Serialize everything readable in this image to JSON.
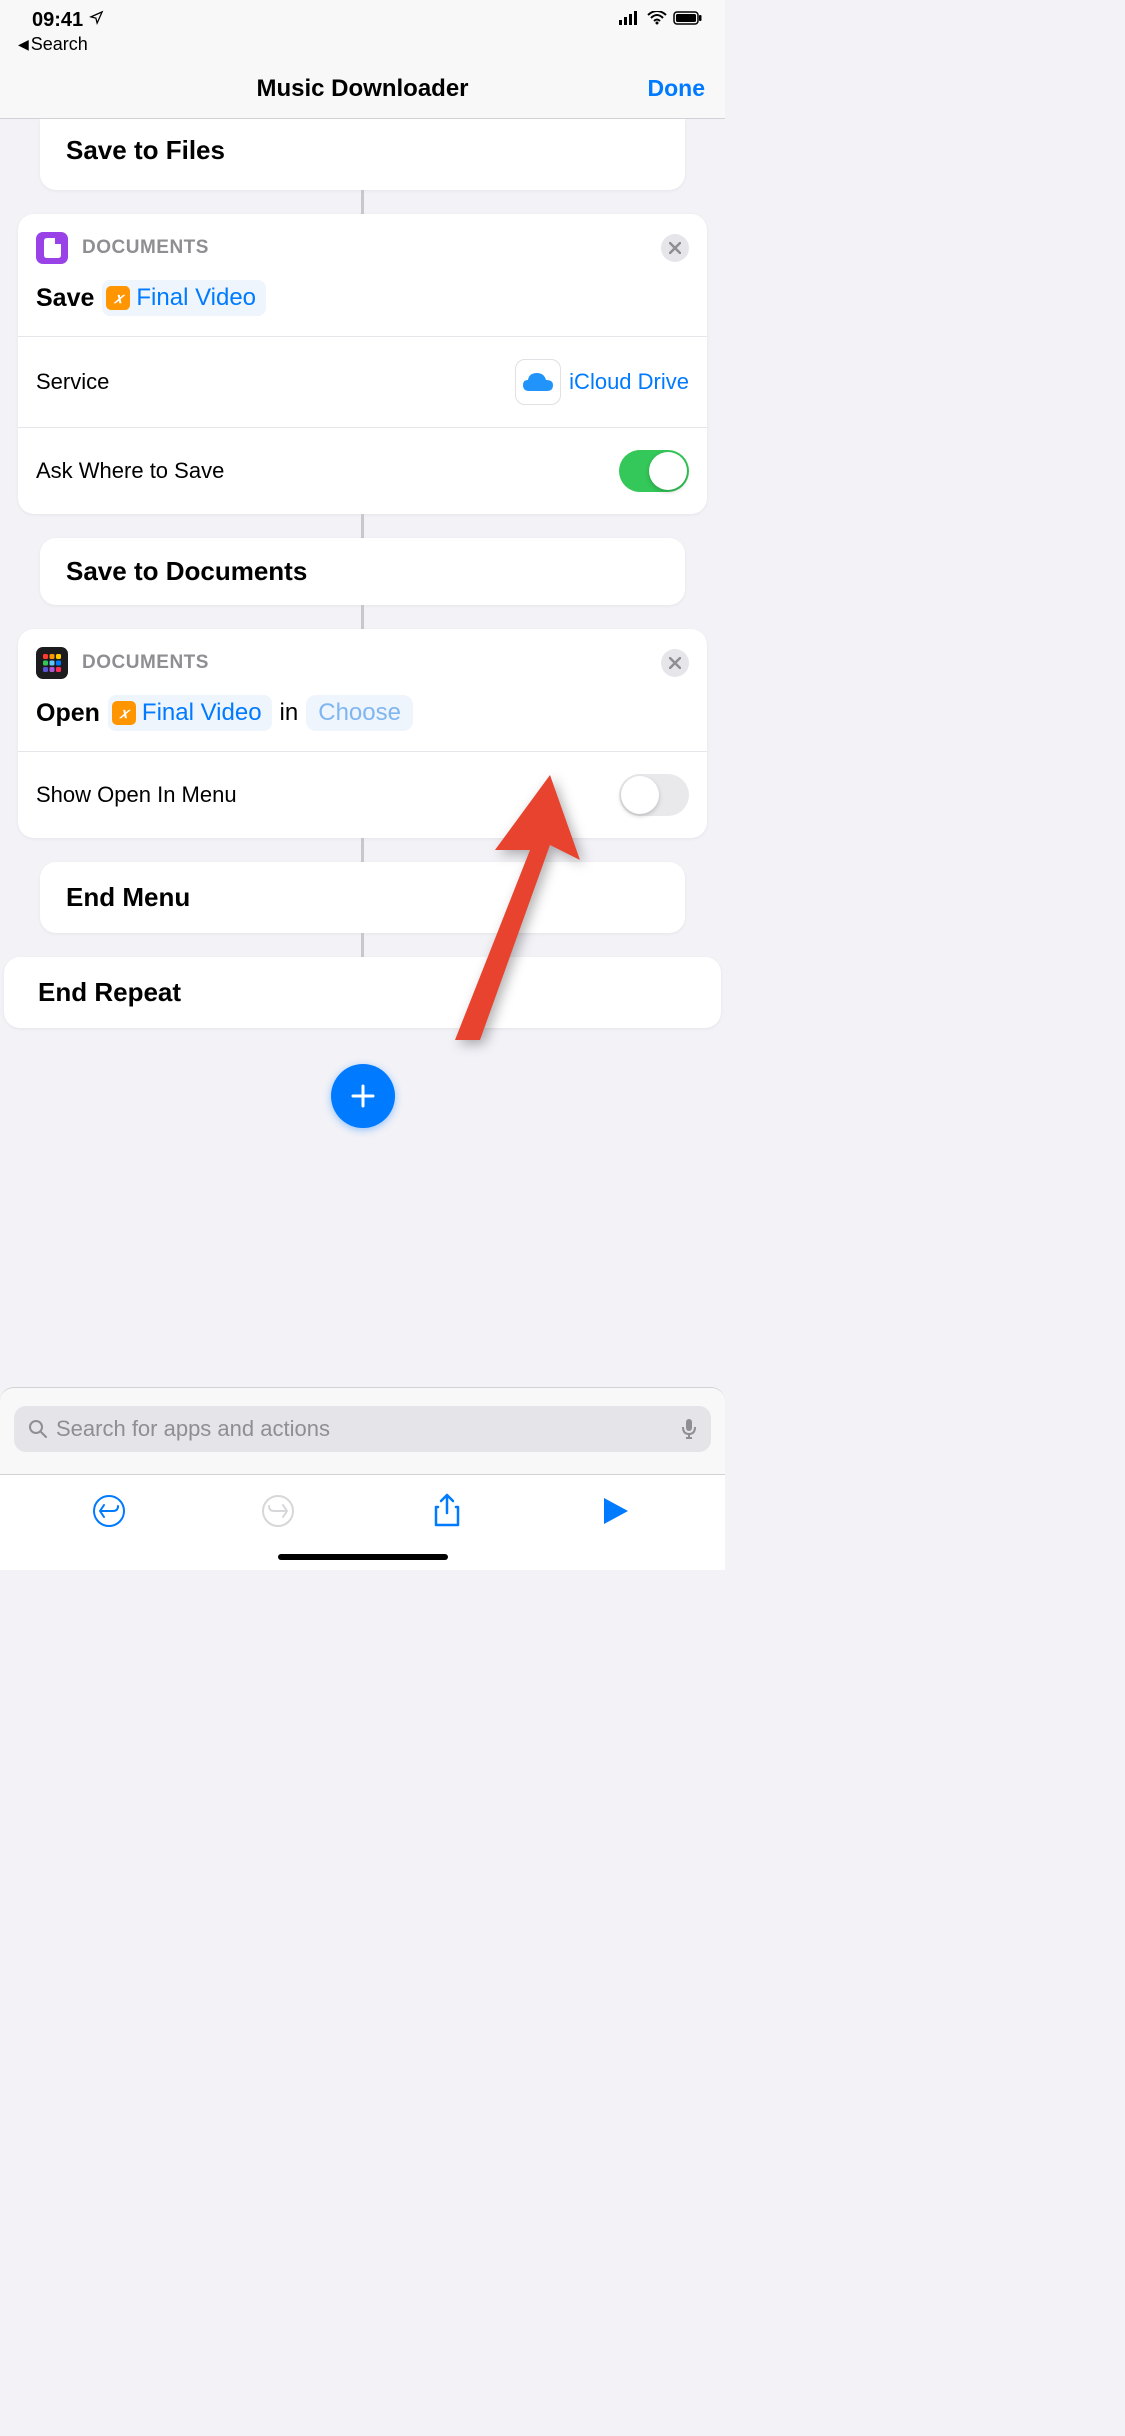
{
  "status": {
    "time": "09:41",
    "back_label": "Search"
  },
  "nav": {
    "title": "Music Downloader",
    "done": "Done"
  },
  "blocks": {
    "save_to_files": "Save to Files",
    "save_to_documents": "Save to Documents",
    "end_menu": "End Menu",
    "end_repeat": "End Repeat"
  },
  "action1": {
    "header_label": "DOCUMENTS",
    "verb": "Save",
    "variable": "Final Video",
    "service_label": "Service",
    "service_value": "iCloud Drive",
    "ask_label": "Ask Where to Save"
  },
  "action2": {
    "header_label": "DOCUMENTS",
    "verb": "Open",
    "variable": "Final Video",
    "in_label": "in",
    "choose": "Choose",
    "show_menu_label": "Show Open In Menu"
  },
  "search": {
    "placeholder": "Search for apps and actions"
  }
}
